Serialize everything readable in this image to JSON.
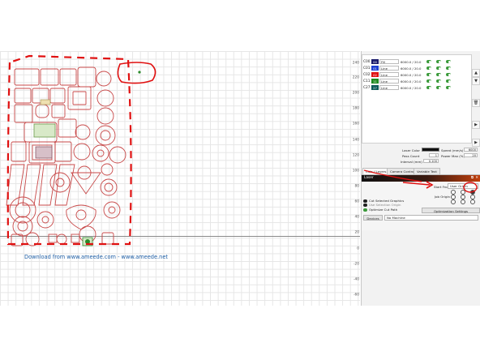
{
  "canvas": {
    "ruler_ticks": [
      "240",
      "220",
      "200",
      "180",
      "160",
      "140",
      "120",
      "100",
      "80",
      "60",
      "40",
      "20",
      "0",
      "-20",
      "-40",
      "-60",
      "-80"
    ],
    "watermark": "Download from www.ameede.com - www.ameede.net"
  },
  "layers": [
    {
      "name": "C00",
      "num": "00",
      "mode": "Fill",
      "speed_power": "6000.0 / 20.0",
      "color": "#1a1a6a"
    },
    {
      "name": "C01",
      "num": "01",
      "mode": "Line",
      "speed_power": "6000.0 / 20.0",
      "color": "#1f3fd1"
    },
    {
      "name": "C02",
      "num": "02",
      "mode": "Line",
      "speed_power": "6000.0 / 20.0",
      "color": "#e01010"
    },
    {
      "name": "C11",
      "num": "11",
      "mode": "Line",
      "speed_power": "6000.0 / 20.0",
      "color": "#1e8a1e"
    },
    {
      "name": "C27",
      "num": "27",
      "mode": "Line",
      "speed_power": "6000.0 / 20.0",
      "color": "#0b5a56"
    }
  ],
  "side_buttons": [
    "▲",
    "▼",
    "🗑",
    "▶",
    "▶"
  ],
  "properties": {
    "laser_color_label": "Laser Color",
    "speed_label": "Speed (mm/s)",
    "speed_value": "6000",
    "pass_count_label": "Pass Count",
    "pass_count_value": "1",
    "power_max_label": "Power Max (%)",
    "power_max_value": "20",
    "interval_label": "Interval (mm)",
    "interval_value": "0.100"
  },
  "tabs": [
    "Cuts / Layers",
    "Camera Control",
    "Variable Text"
  ],
  "laser": {
    "title": "Laser",
    "start_from_label": "Start From:",
    "start_from_value": "User Origin",
    "job_origin_label": "Job Origin",
    "cut_selected": "Cut Selected Graphics",
    "use_selection_origin": "Use Selection Origin",
    "optimize": "Optimize Cut Path",
    "optimization_settings": "Optimization Settings",
    "devices": "Devices",
    "machine": "No Machine"
  },
  "colors": {
    "accent": "#c2400d",
    "annotation": "#e01010",
    "parts": "#c84848",
    "grid": "#e6e6e6"
  }
}
